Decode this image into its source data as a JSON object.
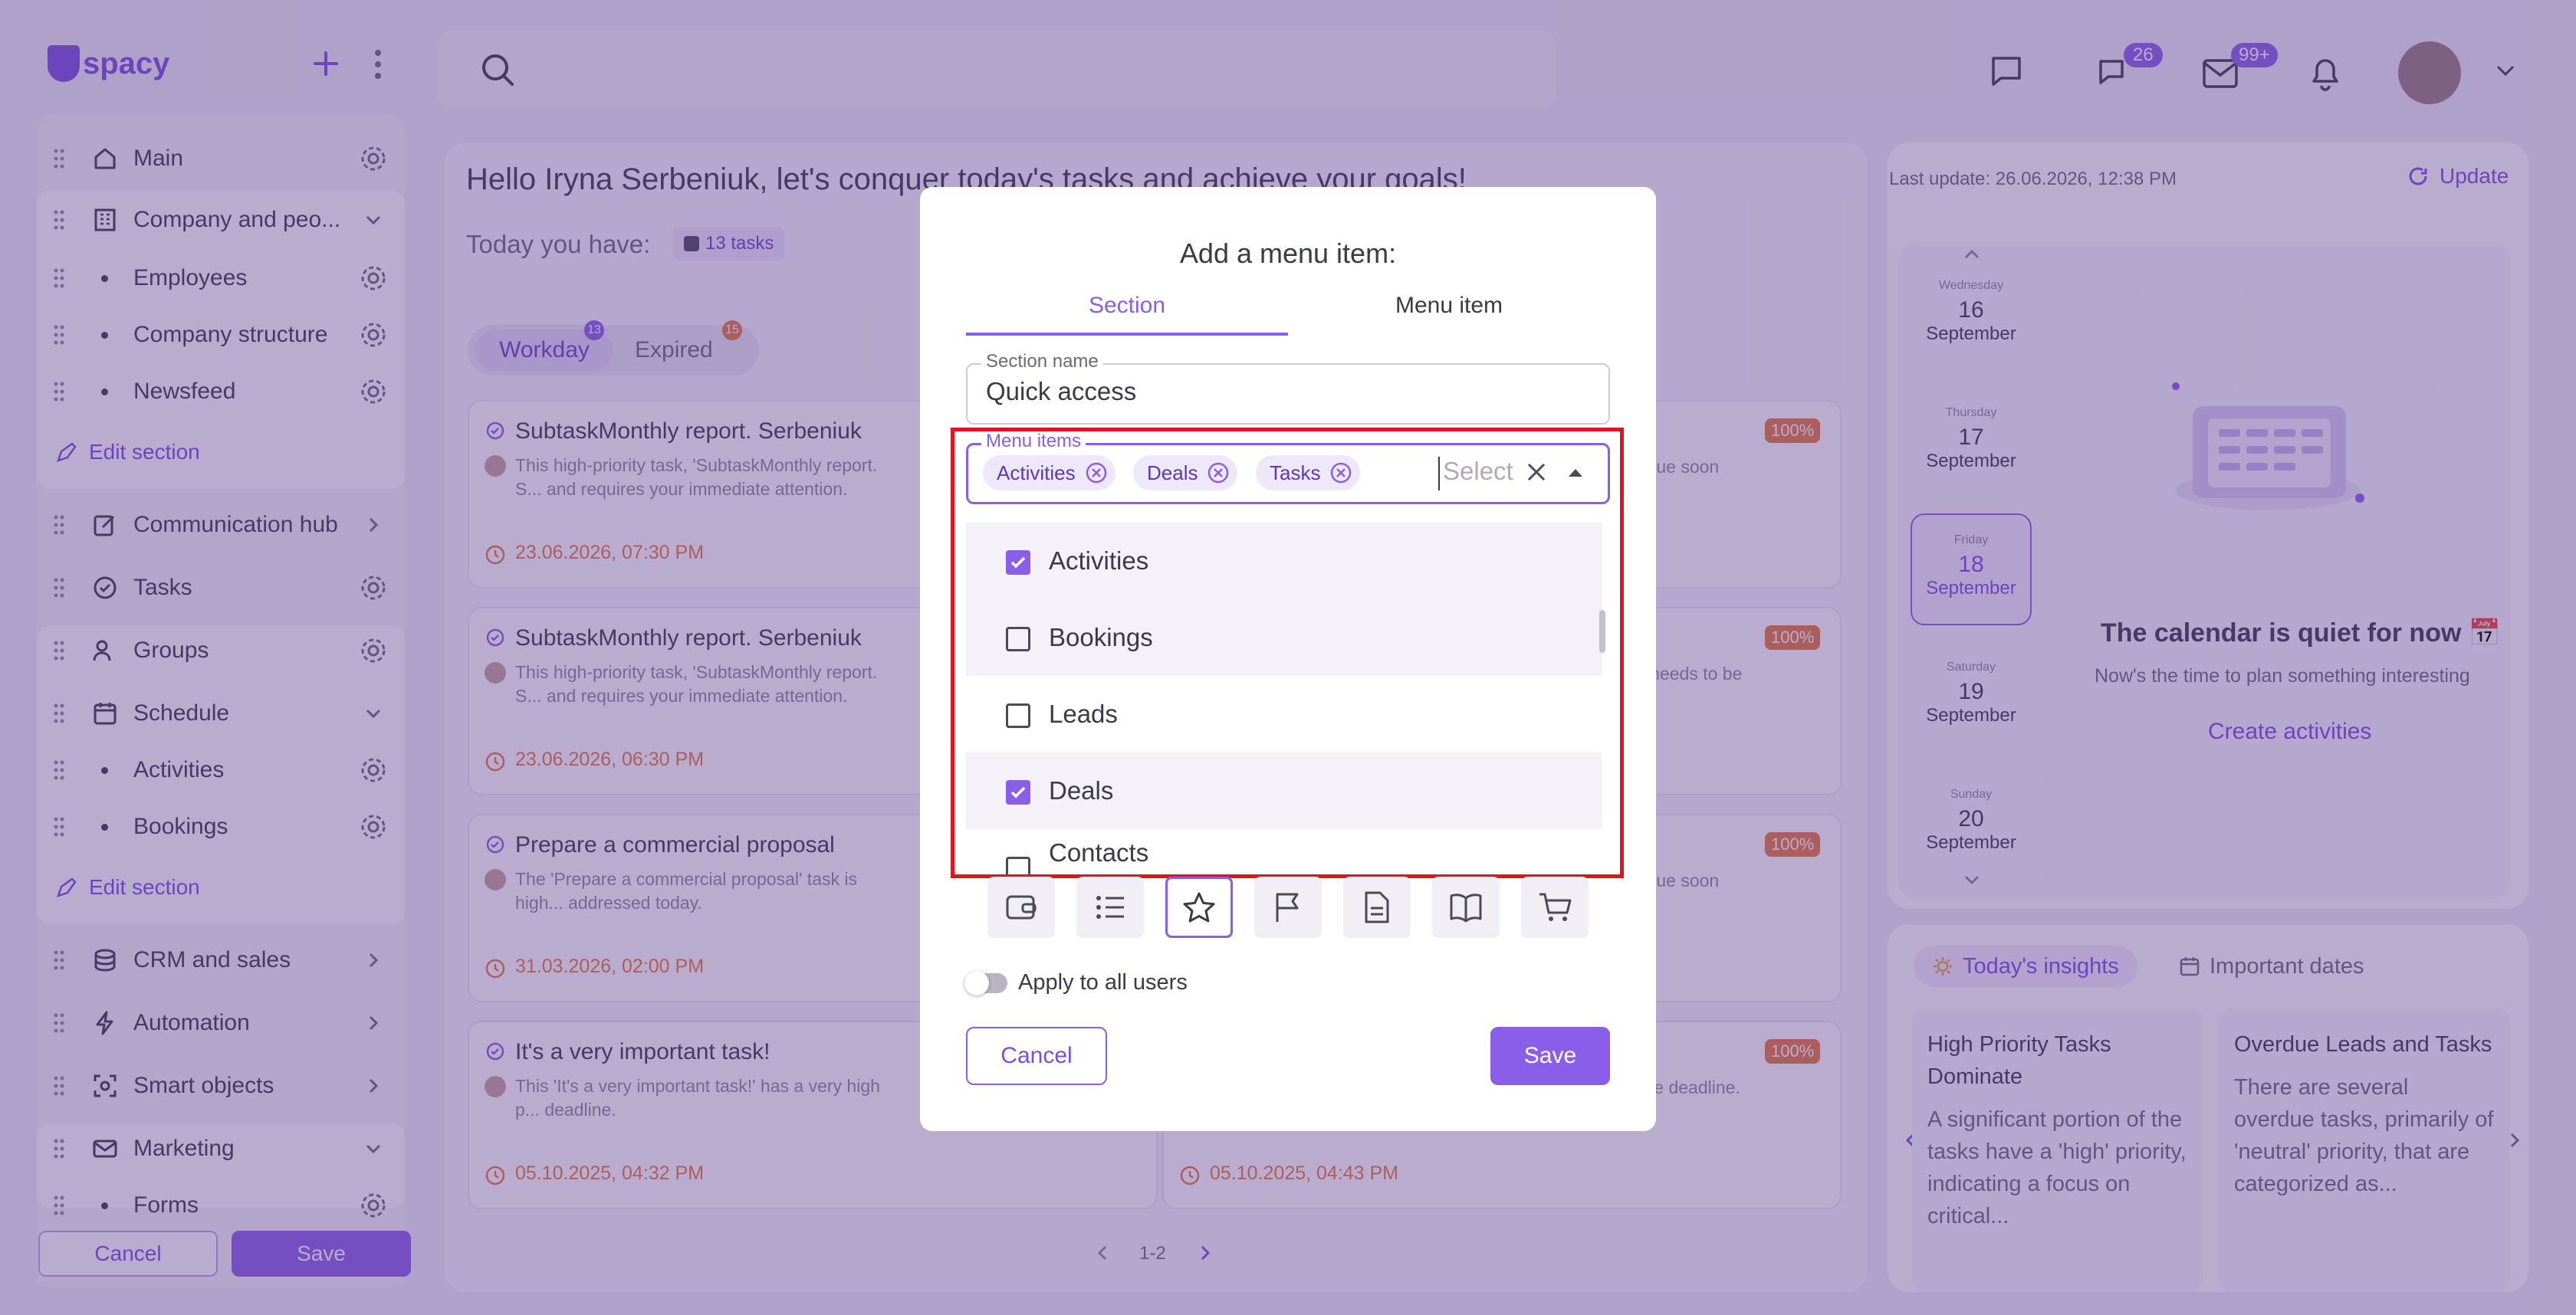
{
  "app": {
    "logo_text": "spacy",
    "brand_color": "#7b4ee0"
  },
  "topbar": {
    "chat_badge": "26",
    "mail_badge": "99+"
  },
  "sidebar": {
    "items": [
      {
        "label": "Main"
      },
      {
        "label": "Company and peo..."
      },
      {
        "label": "Employees"
      },
      {
        "label": "Company structure"
      },
      {
        "label": "Newsfeed"
      },
      {
        "label": "Communication hub"
      },
      {
        "label": "Tasks"
      },
      {
        "label": "Groups"
      },
      {
        "label": "Schedule"
      },
      {
        "label": "Activities"
      },
      {
        "label": "Bookings"
      },
      {
        "label": "CRM and sales"
      },
      {
        "label": "Automation"
      },
      {
        "label": "Smart objects"
      },
      {
        "label": "Marketing"
      },
      {
        "label": "Forms"
      }
    ],
    "edit_section_label": "Edit section",
    "cancel_label": "Cancel",
    "save_label": "Save"
  },
  "main": {
    "greeting": "Hello Iryna Serbeniuk, let's conquer today's tasks and achieve your goals!",
    "today_label": "Today you have:",
    "tasks_chip": "13 tasks",
    "tabs": [
      {
        "label": "Workday",
        "badge": "13"
      },
      {
        "label": "Expired",
        "badge": "15"
      }
    ],
    "cards": [
      {
        "title": "SubtaskMonthly report. Serbeniuk",
        "desc": "This high-priority task, 'SubtaskMonthly report. S... and requires your immediate attention.",
        "date": "23.06.2026, 07:30 PM"
      },
      {
        "title": "SubtaskMonthly report. Serbeniuk",
        "desc": "This high-priority task, 'SubtaskMonthly report. S... and requires your immediate attention.",
        "date": "23.06.2026, 06:30 PM"
      },
      {
        "title": "Prepare a commercial proposal",
        "desc": "The 'Prepare a commercial proposal' task is high... addressed today.",
        "date": "31.03.2026, 02:00 PM"
      },
      {
        "title": "It's a very important task!",
        "desc": "This 'It's a very important task!' has a very high p... deadline.",
        "date": "05.10.2025, 04:32 PM"
      }
    ],
    "right_cards": [
      {
        "text": "iuk', is due soon",
        "pct": "100%"
      },
      {
        "text": "ity and needs to be",
        "pct": "100%"
      },
      {
        "text": "iuk', is due soon",
        "pct": "100%"
      },
      {
        "text": "d a close deadline.",
        "pct": "100%",
        "date": "05.10.2025, 04:43 PM"
      }
    ],
    "pagination": "1-2"
  },
  "calendar": {
    "last_update": "Last update: 26.06.2026, 12:38 PM",
    "update_label": "Update",
    "days": [
      {
        "weekday": "Wednesday",
        "day": "16",
        "month": "September"
      },
      {
        "weekday": "Thursday",
        "day": "17",
        "month": "September"
      },
      {
        "weekday": "Friday",
        "day": "18",
        "month": "September"
      },
      {
        "weekday": "Saturday",
        "day": "19",
        "month": "September"
      },
      {
        "weekday": "Sunday",
        "day": "20",
        "month": "September"
      }
    ],
    "quiet_title": "The calendar is quiet for now 📅",
    "quiet_sub": "Now's the time to plan something interesting",
    "create_label": "Create activities"
  },
  "insights": {
    "tabs": [
      {
        "label": "Today's insights"
      },
      {
        "label": "Important dates"
      }
    ],
    "cards": [
      {
        "title": "High Priority Tasks Dominate",
        "body": "A significant portion of the tasks have a 'high' priority, indicating a focus on critical..."
      },
      {
        "title": "Overdue Leads and Tasks",
        "body": "There are several overdue tasks, primarily of 'neutral' priority, that are categorized as..."
      }
    ]
  },
  "modal": {
    "title": "Add a menu item:",
    "tabs": [
      {
        "label": "Section"
      },
      {
        "label": "Menu item"
      }
    ],
    "section_name_label": "Section name",
    "section_name_value": "Quick access",
    "menu_items_label": "Menu items",
    "chips": [
      {
        "label": "Activities"
      },
      {
        "label": "Deals"
      },
      {
        "label": "Tasks"
      }
    ],
    "select_placeholder": "Select",
    "options": [
      {
        "label": "Activities",
        "checked": true
      },
      {
        "label": "Bookings",
        "checked": false
      },
      {
        "label": "Leads",
        "checked": false
      },
      {
        "label": "Deals",
        "checked": true
      },
      {
        "label": "Contacts",
        "checked": false
      }
    ],
    "icon_choices": [
      "wallet-icon",
      "list-icon",
      "star-icon",
      "flag-icon",
      "document-icon",
      "book-icon",
      "cart-icon"
    ],
    "apply_all_label": "Apply to all users",
    "cancel_label": "Cancel",
    "save_label": "Save",
    "highlight_color": "#e0141e"
  }
}
